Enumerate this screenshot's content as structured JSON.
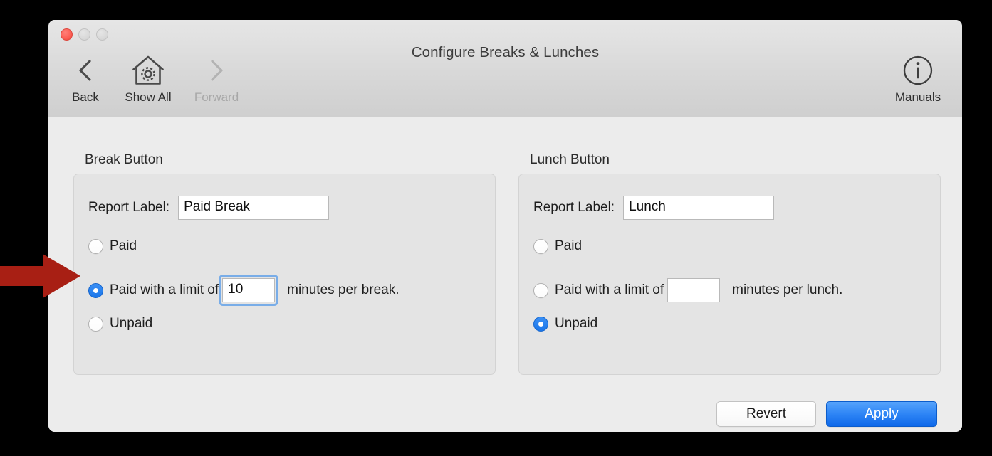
{
  "window": {
    "title": "Configure Breaks & Lunches",
    "traffic_lights": [
      "close",
      "minimize",
      "zoom"
    ]
  },
  "toolbar": {
    "back": {
      "label": "Back",
      "icon": "chevron-left-icon",
      "enabled": true
    },
    "show_all": {
      "label": "Show All",
      "icon": "home-gear-icon",
      "enabled": true
    },
    "forward": {
      "label": "Forward",
      "icon": "chevron-right-icon",
      "enabled": false
    },
    "manuals": {
      "label": "Manuals",
      "icon": "info-circle-icon",
      "enabled": true
    }
  },
  "sections": {
    "break": {
      "title": "Break Button",
      "report_label_caption": "Report Label:",
      "report_label_value": "Paid Break",
      "report_label_placeholder": "",
      "options": [
        {
          "label": "Paid",
          "selected": false
        },
        {
          "label": "Paid with a limit of",
          "selected": true
        },
        {
          "label": "Unpaid",
          "selected": false
        }
      ],
      "minutes_value": "10",
      "minutes_placeholder": "",
      "minutes_focused": true,
      "minutes_suffix": "minutes per break."
    },
    "lunch": {
      "title": "Lunch Button",
      "report_label_caption": "Report Label:",
      "report_label_value": "Lunch",
      "report_label_placeholder": "",
      "options": [
        {
          "label": "Paid",
          "selected": false
        },
        {
          "label": "Paid with a limit of",
          "selected": false
        },
        {
          "label": "Unpaid",
          "selected": true
        }
      ],
      "minutes_value": "",
      "minutes_placeholder": "",
      "minutes_focused": false,
      "minutes_suffix": "minutes per lunch."
    }
  },
  "footer": {
    "revert_label": "Revert",
    "apply_label": "Apply"
  },
  "annotation": {
    "arrow_color": "#a81f14",
    "points_at": "break-option-paid-with-limit"
  },
  "colors": {
    "accent_blue": "#1a76ea",
    "default_button_blue": "#2f86f6",
    "focus_ring": "#79ade8",
    "window_bg": "#ececec",
    "group_bg": "#e4e4e4",
    "close_red": "#fc5c52"
  }
}
